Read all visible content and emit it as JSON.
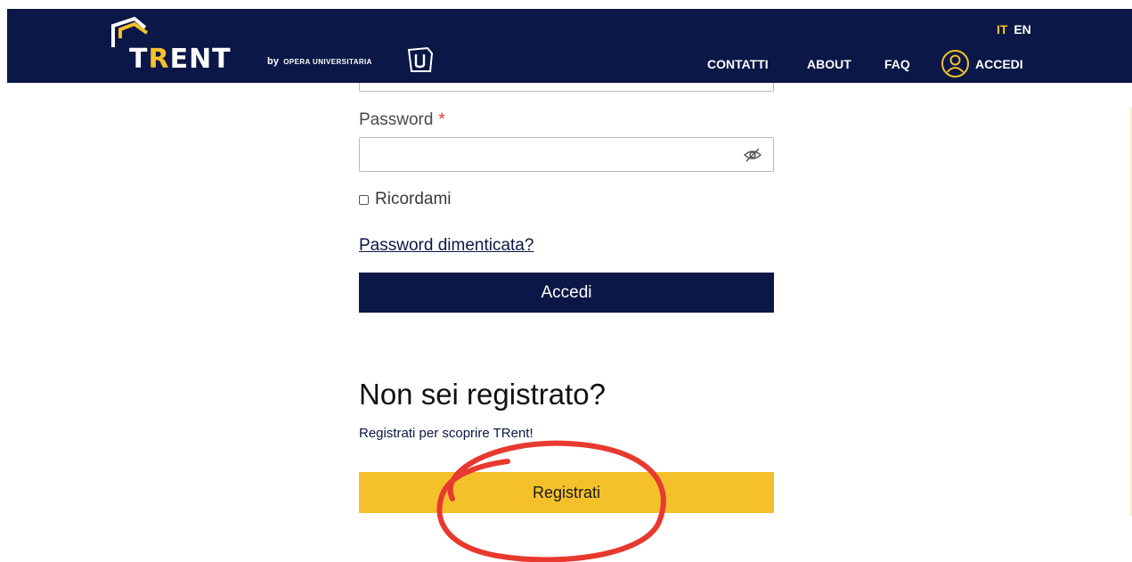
{
  "header": {
    "logo_prefix": "T",
    "logo_accent": "R",
    "logo_suffix": "ENT",
    "byline_by": "by",
    "byline_org": "OPERA UNIVERSITARIA",
    "lang_it": "IT",
    "lang_en": "EN",
    "nav": {
      "contatti": "CONTATTI",
      "about": "ABOUT",
      "faq": "FAQ",
      "accedi": "ACCEDI"
    }
  },
  "form": {
    "password_label": "Password",
    "required_mark": "*",
    "password_value": "",
    "remember_label": "Ricordami",
    "forgot_link": "Password dimenticata?",
    "login_button": "Accedi"
  },
  "register": {
    "heading": "Non sei registrato?",
    "subtitle": "Registrati per scoprire TRent!",
    "button": "Registrati"
  },
  "colors": {
    "navy": "#0b1746",
    "yellow": "#f4c12b",
    "annotation_red": "#e8392f"
  },
  "icons": {
    "user": "user-circle-icon",
    "eye": "eye-slash-icon"
  }
}
